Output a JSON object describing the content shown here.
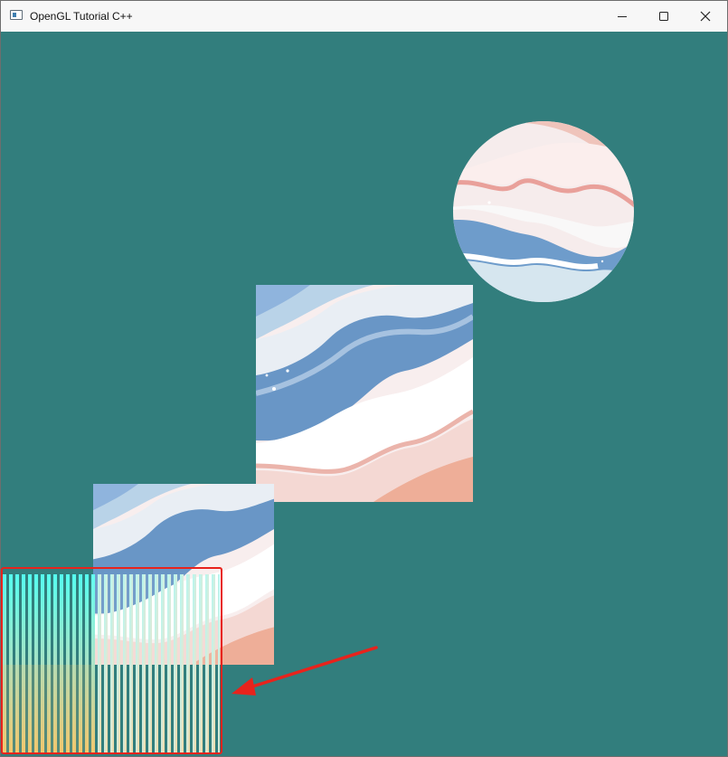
{
  "window": {
    "title": "OpenGL Tutorial C++",
    "app_icon": "window-app-icon",
    "controls": {
      "minimize_icon": "minimize-icon",
      "maximize_icon": "maximize-icon",
      "close_icon": "close-icon"
    }
  },
  "scene": {
    "clear_color": "#327e7d",
    "texture_colors": {
      "white": "#fbf5f3",
      "blue": "#5f8fc0",
      "light_blue": "#b7d2e6",
      "pink": "#f2c9c4",
      "coral": "#eea58e",
      "cyan": "#55fff0",
      "yellow": "#f2c86e"
    },
    "objects": [
      {
        "name": "circle-textured-quad",
        "shape": "circle"
      },
      {
        "name": "large-textured-square",
        "shape": "square"
      },
      {
        "name": "small-textured-square",
        "shape": "square"
      },
      {
        "name": "striped-gradient-quad",
        "shape": "square"
      }
    ]
  },
  "annotation": {
    "highlight_color": "#e8231c",
    "arrow_color": "#e8231c",
    "arrow_icon": "arrow-icon"
  }
}
